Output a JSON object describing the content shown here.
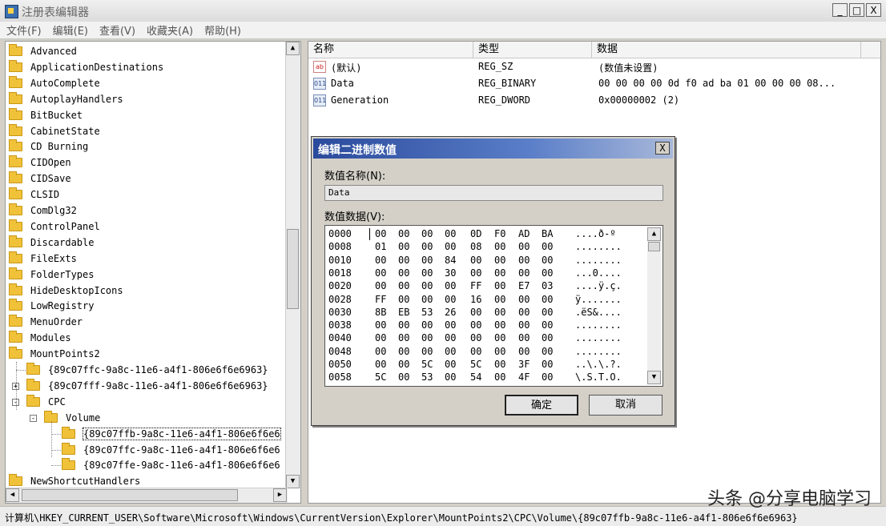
{
  "window": {
    "title": "注册表编辑器",
    "minimize": "_",
    "maximize": "□",
    "close": "X"
  },
  "menu": [
    "文件(F)",
    "编辑(E)",
    "查看(V)",
    "收藏夹(A)",
    "帮助(H)"
  ],
  "tree": {
    "items": [
      {
        "label": "Advanced",
        "indent": 0
      },
      {
        "label": "ApplicationDestinations",
        "indent": 0
      },
      {
        "label": "AutoComplete",
        "indent": 0
      },
      {
        "label": "AutoplayHandlers",
        "indent": 0
      },
      {
        "label": "BitBucket",
        "indent": 0
      },
      {
        "label": "CabinetState",
        "indent": 0
      },
      {
        "label": "CD Burning",
        "indent": 0
      },
      {
        "label": "CIDOpen",
        "indent": 0
      },
      {
        "label": "CIDSave",
        "indent": 0
      },
      {
        "label": "CLSID",
        "indent": 0
      },
      {
        "label": "ComDlg32",
        "indent": 0
      },
      {
        "label": "ControlPanel",
        "indent": 0
      },
      {
        "label": "Discardable",
        "indent": 0
      },
      {
        "label": "FileExts",
        "indent": 0
      },
      {
        "label": "FolderTypes",
        "indent": 0
      },
      {
        "label": "HideDesktopIcons",
        "indent": 0
      },
      {
        "label": "LowRegistry",
        "indent": 0
      },
      {
        "label": "MenuOrder",
        "indent": 0
      },
      {
        "label": "Modules",
        "indent": 0
      },
      {
        "label": "MountPoints2",
        "indent": 0
      },
      {
        "label": "{89c07ffc-9a8c-11e6-a4f1-806e6f6e6963}",
        "indent": 1
      },
      {
        "label": "{89c07fff-9a8c-11e6-a4f1-806e6f6e6963}",
        "indent": 1,
        "expander": "+"
      },
      {
        "label": "CPC",
        "indent": 1,
        "expander": "-"
      },
      {
        "label": "Volume",
        "indent": 2,
        "expander": "-"
      },
      {
        "label": "{89c07ffb-9a8c-11e6-a4f1-806e6f6e6",
        "indent": 3,
        "selected": true
      },
      {
        "label": "{89c07ffc-9a8c-11e6-a4f1-806e6f6e6",
        "indent": 3
      },
      {
        "label": "{89c07ffe-9a8c-11e6-a4f1-806e6f6e6",
        "indent": 3
      },
      {
        "label": "NewShortcutHandlers",
        "indent": 0
      }
    ]
  },
  "list": {
    "columns": [
      "名称",
      "类型",
      "数据"
    ],
    "rows": [
      {
        "icon": "ab",
        "name": "(默认)",
        "type": "REG_SZ",
        "data": "(数值未设置)"
      },
      {
        "icon": "bin",
        "name": "Data",
        "type": "REG_BINARY",
        "data": "00 00 00 00 0d f0 ad ba 01 00 00 00 08..."
      },
      {
        "icon": "bin",
        "name": "Generation",
        "type": "REG_DWORD",
        "data": "0x00000002 (2)"
      }
    ]
  },
  "dialog": {
    "title": "编辑二进制数值",
    "close": "X",
    "name_label": "数值名称(N):",
    "name_value": "Data",
    "data_label": "数值数据(V):",
    "hex_rows": [
      {
        "offset": "0000",
        "bytes": [
          "00",
          "00",
          "00",
          "00",
          "0D",
          "F0",
          "AD",
          "BA"
        ],
        "ascii": "....ð-º"
      },
      {
        "offset": "0008",
        "bytes": [
          "01",
          "00",
          "00",
          "00",
          "08",
          "00",
          "00",
          "00"
        ],
        "ascii": "........"
      },
      {
        "offset": "0010",
        "bytes": [
          "00",
          "00",
          "00",
          "84",
          "00",
          "00",
          "00",
          "00"
        ],
        "ascii": "........"
      },
      {
        "offset": "0018",
        "bytes": [
          "00",
          "00",
          "00",
          "30",
          "00",
          "00",
          "00",
          "00"
        ],
        "ascii": "...0...."
      },
      {
        "offset": "0020",
        "bytes": [
          "00",
          "00",
          "00",
          "00",
          "FF",
          "00",
          "E7",
          "03"
        ],
        "ascii": "....ÿ.ç."
      },
      {
        "offset": "0028",
        "bytes": [
          "FF",
          "00",
          "00",
          "00",
          "16",
          "00",
          "00",
          "00"
        ],
        "ascii": "ÿ......."
      },
      {
        "offset": "0030",
        "bytes": [
          "8B",
          "EB",
          "53",
          "26",
          "00",
          "00",
          "00",
          "00"
        ],
        "ascii": ".ëS&...."
      },
      {
        "offset": "0038",
        "bytes": [
          "00",
          "00",
          "00",
          "00",
          "00",
          "00",
          "00",
          "00"
        ],
        "ascii": "........"
      },
      {
        "offset": "0040",
        "bytes": [
          "00",
          "00",
          "00",
          "00",
          "00",
          "00",
          "00",
          "00"
        ],
        "ascii": "........"
      },
      {
        "offset": "0048",
        "bytes": [
          "00",
          "00",
          "00",
          "00",
          "00",
          "00",
          "00",
          "00"
        ],
        "ascii": "........"
      },
      {
        "offset": "0050",
        "bytes": [
          "00",
          "00",
          "5C",
          "00",
          "5C",
          "00",
          "3F",
          "00"
        ],
        "ascii": "..\\.\\.?."
      },
      {
        "offset": "0058",
        "bytes": [
          "5C",
          "00",
          "53",
          "00",
          "54",
          "00",
          "4F",
          "00"
        ],
        "ascii": "\\.S.T.O."
      }
    ],
    "ok": "确定",
    "cancel": "取消"
  },
  "status": "计算机\\HKEY_CURRENT_USER\\Software\\Microsoft\\Windows\\CurrentVersion\\Explorer\\MountPoints2\\CPC\\Volume\\{89c07ffb-9a8c-11e6-a4f1-806e6f6e6963}",
  "watermark": "头条 @分享电脑学习",
  "colors": {
    "dialog_title_start": "#2a4a9c",
    "folder": "#f0c23a",
    "window_bg": "#d4d0c8"
  }
}
